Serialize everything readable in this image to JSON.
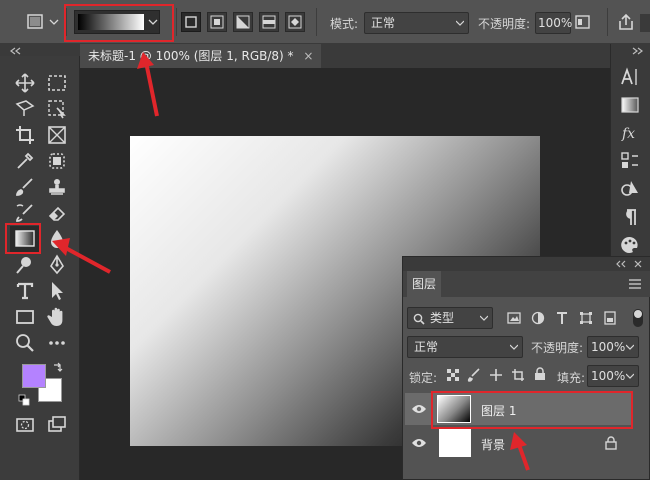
{
  "options_bar": {
    "mode_label": "模式:",
    "mode_value": "正常",
    "opacity_label": "不透明度:",
    "opacity_value": "100%"
  },
  "document_tab": {
    "title": "未标题-1 @ 100% (图层 1, RGB/8) *",
    "close": "×"
  },
  "layers_panel": {
    "tab_label": "图层",
    "filter_value": "类型",
    "blend_value": "正常",
    "opacity_label": "不透明度:",
    "opacity_value": "100%",
    "lock_label": "锁定:",
    "fill_label": "填充:",
    "fill_value": "100%",
    "layers": [
      {
        "name": "图层 1"
      },
      {
        "name": "背景"
      }
    ]
  },
  "colors": {
    "foreground": "#b482ff",
    "background": "#ffffff",
    "highlight": "#e0262b"
  }
}
